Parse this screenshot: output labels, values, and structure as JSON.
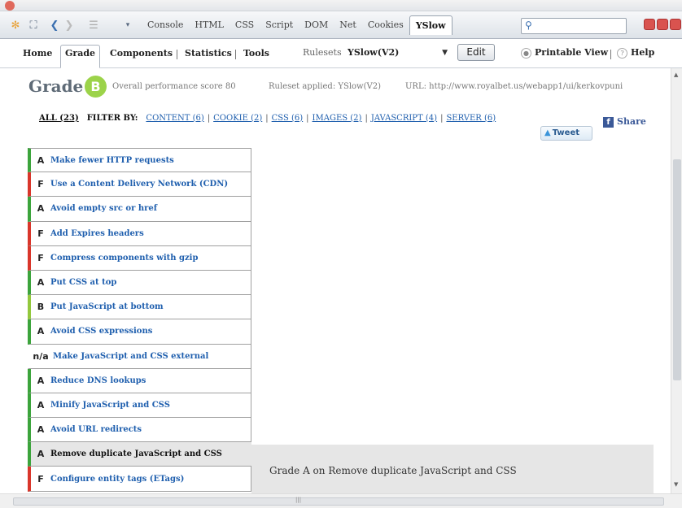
{
  "firebug": {
    "tabs": [
      "Console",
      "HTML",
      "CSS",
      "Script",
      "DOM",
      "Net",
      "Cookies",
      "YSlow"
    ],
    "active_tab": "YSlow",
    "search_placeholder": ""
  },
  "yslow_nav": {
    "tabs": [
      "Home",
      "Grade",
      "Components",
      "Statistics",
      "Tools"
    ],
    "active_tab": "Grade",
    "rulesets_label": "Rulesets",
    "ruleset_value": "YSlow(V2)",
    "edit_label": "Edit",
    "printable_view": "Printable View",
    "help": "Help"
  },
  "grade": {
    "title": "Grade",
    "letter": "B",
    "overall_label": "Overall performance score 80",
    "ruleset_applied": "Ruleset applied: YSlow(V2)",
    "url": "URL: http://www.royalbet.us/webapp1/ui/kerkovpuni"
  },
  "filters": {
    "all": "ALL (23)",
    "filter_by": "FILTER BY:",
    "links": [
      "CONTENT (6)",
      "COOKIE (2)",
      "CSS (6)",
      "IMAGES (2)",
      "JAVASCRIPT (4)",
      "SERVER (6)"
    ]
  },
  "social": {
    "tweet": "Tweet",
    "share": "Share"
  },
  "rules": [
    {
      "grade": "A",
      "text": "Make fewer HTTP requests"
    },
    {
      "grade": "F",
      "text": "Use a Content Delivery Network (CDN)"
    },
    {
      "grade": "A",
      "text": "Avoid empty src or href"
    },
    {
      "grade": "F",
      "text": "Add Expires headers"
    },
    {
      "grade": "F",
      "text": "Compress components with gzip"
    },
    {
      "grade": "A",
      "text": "Put CSS at top"
    },
    {
      "grade": "B",
      "text": "Put JavaScript at bottom"
    },
    {
      "grade": "A",
      "text": "Avoid CSS expressions"
    },
    {
      "grade": "n/a",
      "text": "Make JavaScript and CSS external"
    },
    {
      "grade": "A",
      "text": "Reduce DNS lookups"
    },
    {
      "grade": "A",
      "text": "Minify JavaScript and CSS"
    },
    {
      "grade": "A",
      "text": "Avoid URL redirects"
    },
    {
      "grade": "A",
      "text": "Remove duplicate JavaScript and CSS"
    },
    {
      "grade": "F",
      "text": "Configure entity tags (ETags)"
    }
  ],
  "selected_rule_index": 12,
  "detail": {
    "text": "Grade A on Remove duplicate JavaScript and CSS"
  },
  "colors": {
    "grade_A": "#3ca43c",
    "grade_B": "#93c83d",
    "grade_F": "#d9362b",
    "link": "#1f5fae",
    "badge": "#9cd34a"
  }
}
